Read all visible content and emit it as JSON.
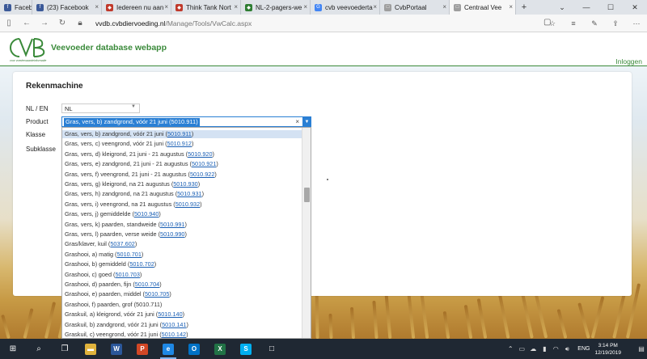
{
  "browser": {
    "tabs": [
      {
        "label": "Facebook",
        "favicon_color": "#3b5998",
        "favicon": "f",
        "active": false,
        "width": 40
      },
      {
        "label": "(23) Facebook",
        "favicon_color": "#3b5998",
        "favicon": "f",
        "active": false,
        "width": 86
      },
      {
        "label": "Iedereen nu aan",
        "favicon_color": "#c0392b",
        "favicon": "◆",
        "active": false,
        "width": 86
      },
      {
        "label": "Think Tank Nort",
        "favicon_color": "#c0392b",
        "favicon": "◆",
        "active": false,
        "width": 86
      },
      {
        "label": "NL-2-pagers-we",
        "favicon_color": "#2e7d32",
        "favicon": "◆",
        "active": false,
        "width": 86
      },
      {
        "label": "cvb veevoederta",
        "favicon_color": "#4285f4",
        "favicon": "G",
        "active": false,
        "width": 86
      },
      {
        "label": "CvbPortaal",
        "favicon_color": "#9e9e9e",
        "favicon": "□",
        "active": false,
        "width": 86
      },
      {
        "label": "Centraal Vee",
        "favicon_color": "#9e9e9e",
        "favicon": "□",
        "active": true,
        "width": 82
      }
    ],
    "new_tab": "+",
    "window_controls": [
      "⌄",
      "—",
      "☐",
      "✕"
    ],
    "url_domain": "vvdb.cvbdiervoeding.nl",
    "url_path": "/Manage/Tools/VwCalc.aspx"
  },
  "header": {
    "logo_text": "CVB",
    "logo_tagline": "voor voederwaardeinformatie",
    "app_title": "Veevoeder database webapp",
    "login": "Inloggen"
  },
  "form": {
    "title": "Rekenmachine",
    "lang_label": "NL / EN",
    "lang_value": "NL",
    "product_label": "Product",
    "product_value": "Gras, vers, b) zandgrond, vóór 21 juni (5010.911)",
    "klasse_label": "Klasse",
    "subklasse_label": "Subklasse"
  },
  "dropdown_options": [
    {
      "text": "Gras, vers, b) zandgrond, vóór 21 juni (",
      "code": "5010.911",
      "end": ")",
      "selected": true
    },
    {
      "text": "Gras, vers, c) veengrond, vóór 21 juni (",
      "code": "5010.912",
      "end": ")"
    },
    {
      "text": "Gras, vers, d) kleigrond, 21 juni - 21 augustus (",
      "code": "5010.920",
      "end": ")"
    },
    {
      "text": "Gras, vers, e) zandgrond, 21 juni - 21 augustus (",
      "code": "5010.921",
      "end": ")"
    },
    {
      "text": "Gras, vers, f) veengrond, 21 juni - 21 augustus (",
      "code": "5010.922",
      "end": ")"
    },
    {
      "text": "Gras, vers, g) kleigrond, na 21 augustus (",
      "code": "5010.930",
      "end": ")"
    },
    {
      "text": "Gras, vers, h) zandgrond, na 21 augustus (",
      "code": "5010.931",
      "end": ")"
    },
    {
      "text": "Gras, vers, i) veengrond, na 21 augustus (",
      "code": "5010.932",
      "end": ")"
    },
    {
      "text": "Gras, vers, j) gemiddelde (",
      "code": "5010.940",
      "end": ")"
    },
    {
      "text": "Gras, vers, k) paarden, standweide (",
      "code": "5010.991",
      "end": ")"
    },
    {
      "text": "Gras, vers, l) paarden, verse weide (",
      "code": "5010.990",
      "end": ")"
    },
    {
      "text": "Gras/klaver, kuil (",
      "code": "5037.602",
      "end": ")"
    },
    {
      "text": "Grashooi, a) matig (",
      "code": "5010.701",
      "end": ")"
    },
    {
      "text": "Grashooi, b) gemiddeld (",
      "code": "5010.702",
      "end": ")"
    },
    {
      "text": "Grashooi, c) goed (",
      "code": "5010.703",
      "end": ")"
    },
    {
      "text": "Grashooi, d) paarden, fijn (",
      "code": "5010.704",
      "end": ")"
    },
    {
      "text": "Grashooi, e) paarden, middel (",
      "code": "5010.705",
      "end": ")"
    },
    {
      "text": "Grashooi, f) paarden, grof (5010.711)",
      "code": "",
      "end": ""
    },
    {
      "text": "Graskuil, a) kleigrond, vóór 21 juni (",
      "code": "5010.140",
      "end": ")"
    },
    {
      "text": "Graskuil, b) zandgrond, vóór 21 juni (",
      "code": "5010.141",
      "end": ")"
    },
    {
      "text": "Graskuil, c) veengrond, vóór 21 juni (",
      "code": "5010.142",
      "end": ")"
    }
  ],
  "taskbar": {
    "language": "ENG",
    "time": "3:14 PM",
    "date": "12/19/2019",
    "apps": [
      {
        "name": "start-icon",
        "glyph": "⊞",
        "bg": ""
      },
      {
        "name": "search-icon",
        "glyph": "⌕",
        "bg": ""
      },
      {
        "name": "task-view-icon",
        "glyph": "❐",
        "bg": ""
      },
      {
        "name": "file-explorer-icon",
        "glyph": "▬",
        "bg": "#e0b33c"
      },
      {
        "name": "word-icon",
        "glyph": "W",
        "bg": "#2b579a"
      },
      {
        "name": "powerpoint-icon",
        "glyph": "P",
        "bg": "#d24726"
      },
      {
        "name": "edge-icon",
        "glyph": "e",
        "bg": "#1e88e5"
      },
      {
        "name": "outlook-icon",
        "glyph": "O",
        "bg": "#0072c6"
      },
      {
        "name": "excel-icon",
        "glyph": "X",
        "bg": "#217346"
      },
      {
        "name": "skype-icon",
        "glyph": "S",
        "bg": "#00aff0"
      },
      {
        "name": "blank-app-icon",
        "glyph": "□",
        "bg": ""
      }
    ]
  },
  "colors": {
    "accent_green": "#3a8a3a",
    "select_blue": "#2a7fd4",
    "link_blue": "#1a5fb4"
  }
}
